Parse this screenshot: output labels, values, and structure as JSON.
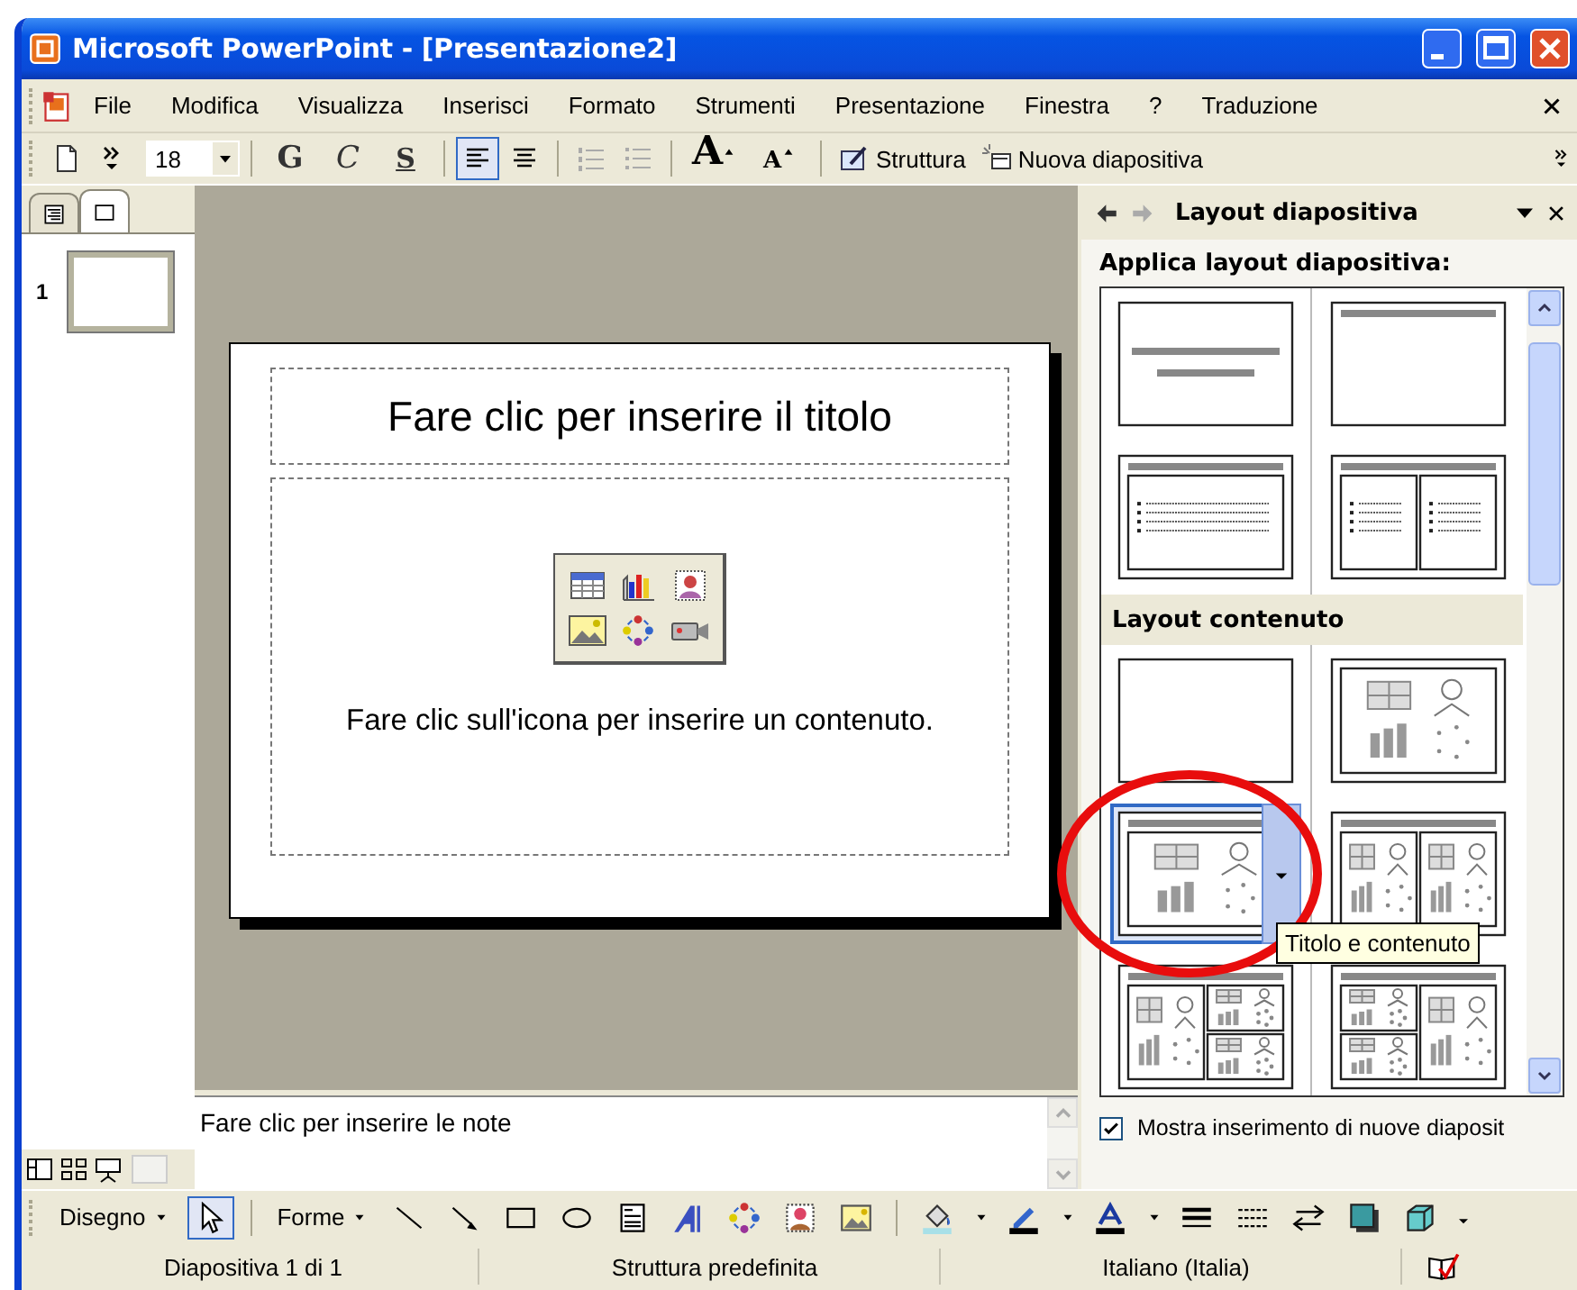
{
  "window": {
    "title": "Microsoft PowerPoint - [Presentazione2]"
  },
  "menu": [
    "File",
    "Modifica",
    "Visualizza",
    "Inserisci",
    "Formato",
    "Strumenti",
    "Presentazione",
    "Finestra",
    "?",
    "Traduzione"
  ],
  "toolbar": [
    {
      "kind": "new"
    },
    {
      "kind": "more"
    },
    {
      "kind": "combo",
      "value": "18"
    },
    {
      "kind": "bold",
      "label": "G",
      "selected": false
    },
    {
      "kind": "italic",
      "label": "C",
      "selected": false
    },
    {
      "kind": "shadow",
      "label": "S",
      "selected": false
    },
    {
      "kind": "align-left",
      "selected": true
    },
    {
      "kind": "align-center",
      "selected": false
    },
    {
      "kind": "numbering",
      "disabled": true
    },
    {
      "kind": "bullets",
      "disabled": true
    },
    {
      "kind": "grow",
      "label": "A"
    },
    {
      "kind": "shrink",
      "label": "A"
    },
    {
      "kind": "design",
      "label": "Struttura"
    },
    {
      "kind": "new-slide",
      "label": "Nuova diapositiva"
    }
  ],
  "slides_panel": {
    "tabs": [
      {
        "kind": "outline",
        "selected": false
      },
      {
        "kind": "slides",
        "selected": true
      }
    ],
    "slides": [
      {
        "number": "1",
        "selected": true
      }
    ]
  },
  "slide": {
    "title_prompt": "Fare clic per inserire il titolo",
    "content_prompt": "Fare clic sull'icona per inserire un contenuto."
  },
  "notes": {
    "placeholder": "Fare clic per inserire le note"
  },
  "task_pane": {
    "title": "Layout diapositiva",
    "apply_label": "Applica layout diapositiva:",
    "sections": [
      {
        "layouts": [
          {
            "kind": "title",
            "selected": false
          },
          {
            "kind": "title-only",
            "selected": false
          },
          {
            "kind": "title-text",
            "selected": false
          },
          {
            "kind": "title-two-text",
            "selected": false
          }
        ]
      },
      {
        "heading": "Layout contenuto",
        "layouts": [
          {
            "kind": "blank",
            "selected": false
          },
          {
            "kind": "content",
            "selected": false
          },
          {
            "kind": "title-content",
            "selected": true
          },
          {
            "kind": "title-two-content",
            "selected": false
          },
          {
            "kind": "title-content-two",
            "selected": false
          },
          {
            "kind": "title-two-content-right",
            "selected": false
          }
        ]
      }
    ],
    "tooltip": "Titolo e contenuto",
    "option": {
      "label": "Mostra inserimento di nuove diaposit",
      "checked": true
    },
    "annotations": [
      {
        "kind": "circle"
      }
    ]
  },
  "drawing_toolbar": [
    {
      "kind": "menu",
      "label": "Disegno"
    },
    {
      "kind": "pointer",
      "selected": true
    },
    {
      "kind": "menu",
      "label": "Forme"
    },
    {
      "kind": "line"
    },
    {
      "kind": "arrow"
    },
    {
      "kind": "rect"
    },
    {
      "kind": "oval"
    },
    {
      "kind": "textbox"
    },
    {
      "kind": "wordart"
    },
    {
      "kind": "diagram"
    },
    {
      "kind": "clipart"
    },
    {
      "kind": "image"
    },
    {
      "kind": "fill"
    },
    {
      "kind": "linecolor"
    },
    {
      "kind": "fontcolor"
    },
    {
      "kind": "linestyle"
    },
    {
      "kind": "dashstyle"
    },
    {
      "kind": "arrowstyle"
    },
    {
      "kind": "shadowstyle"
    },
    {
      "kind": "cube"
    },
    {
      "kind": "more"
    }
  ],
  "status_bar": [
    "Diapositiva 1 di 1",
    "Struttura predefinita",
    "Italiano (Italia)"
  ]
}
